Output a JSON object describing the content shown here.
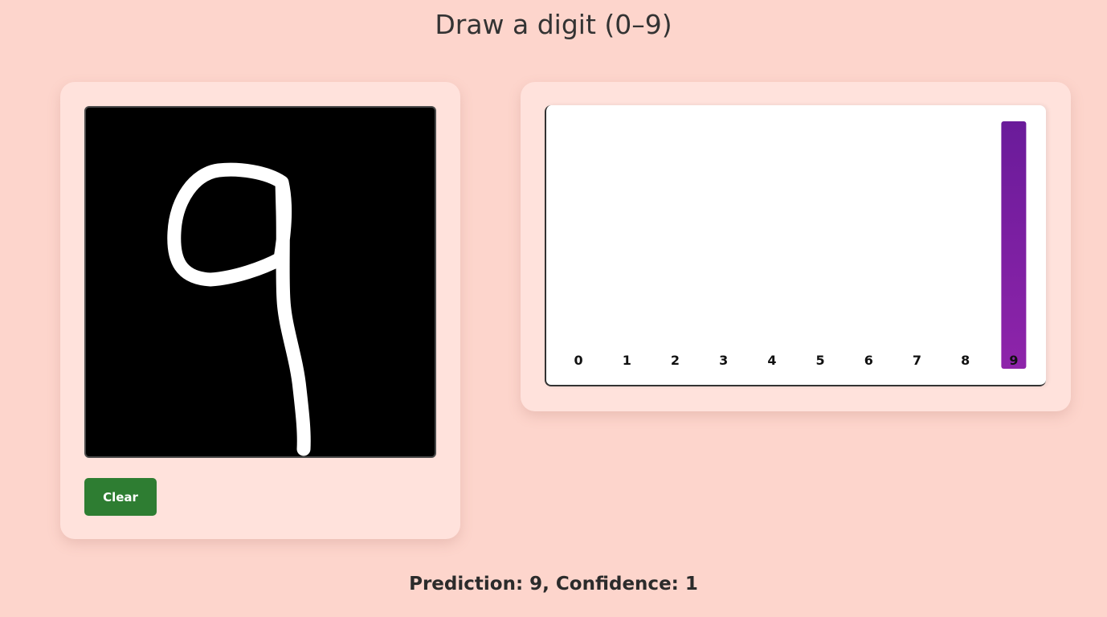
{
  "header": {
    "title": "Draw a digit (0–9)"
  },
  "drawing": {
    "drawn_digit_description": "hand-drawn 9 in white stroke on black canvas"
  },
  "controls": {
    "clear_label": "Clear"
  },
  "result": {
    "text": "Prediction: 9, Confidence: 1",
    "prediction": 9,
    "confidence": 1
  },
  "colors": {
    "page_background": "#fdd5cc",
    "card_background": "#ffe2dc",
    "clear_button": "#2e7d32",
    "bar_top": "#6a1b9a",
    "bar_bottom": "#8e24aa"
  },
  "chart_data": {
    "type": "bar",
    "categories": [
      "0",
      "1",
      "2",
      "3",
      "4",
      "5",
      "6",
      "7",
      "8",
      "9"
    ],
    "values": [
      0,
      0,
      0,
      0,
      0,
      0,
      0,
      0,
      0,
      1
    ],
    "ylim": [
      0,
      1
    ],
    "grid": false
  }
}
